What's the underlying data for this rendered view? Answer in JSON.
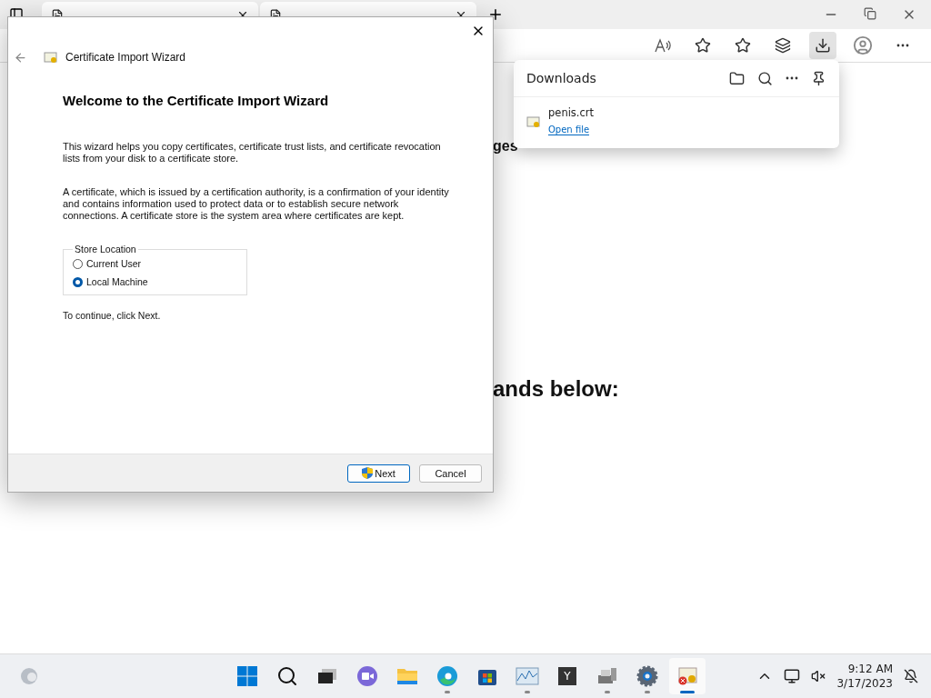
{
  "page": {
    "fragments": [
      "ges",
      "ands below:"
    ]
  },
  "downloads": {
    "title": "Downloads",
    "items": [
      {
        "name": "penis.crt",
        "action": "Open file"
      }
    ]
  },
  "dialog": {
    "title": "Certificate Import Wizard",
    "heading": "Welcome to the Certificate Import Wizard",
    "paragraphs": [
      "This wizard helps you copy certificates, certificate trust lists, and certificate revocation lists from your disk to a certificate store.",
      "A certificate, which is issued by a certification authority, is a confirmation of your identity and contains information used to protect data or to establish secure network connections. A certificate store is the system area where certificates are kept."
    ],
    "group": {
      "label": "Store Location",
      "options": [
        {
          "label": "Current User",
          "selected": false
        },
        {
          "label": "Local Machine",
          "selected": true
        }
      ]
    },
    "hint": "To continue, click Next.",
    "buttons": [
      {
        "label": "Next",
        "kind": "primary"
      },
      {
        "label": "Cancel",
        "kind": "normal"
      }
    ]
  },
  "taskbar": {
    "apps": [
      {
        "kind": "start",
        "running": false,
        "active": false
      },
      {
        "kind": "search",
        "running": false,
        "active": false
      },
      {
        "kind": "taskview",
        "running": false,
        "active": false
      },
      {
        "kind": "chat",
        "running": false,
        "active": false
      },
      {
        "kind": "explorer",
        "running": false,
        "active": false
      },
      {
        "kind": "edge",
        "running": true,
        "active": false
      },
      {
        "kind": "store",
        "running": false,
        "active": false
      },
      {
        "kind": "monitor",
        "running": true,
        "active": false
      },
      {
        "kind": "letter",
        "label": "Y",
        "running": false,
        "active": false
      },
      {
        "kind": "devices",
        "running": true,
        "active": false
      },
      {
        "kind": "settings",
        "running": true,
        "active": false
      },
      {
        "kind": "certificate",
        "running": true,
        "active": true
      }
    ],
    "time": "9:12 AM",
    "date": "3/17/2023"
  }
}
